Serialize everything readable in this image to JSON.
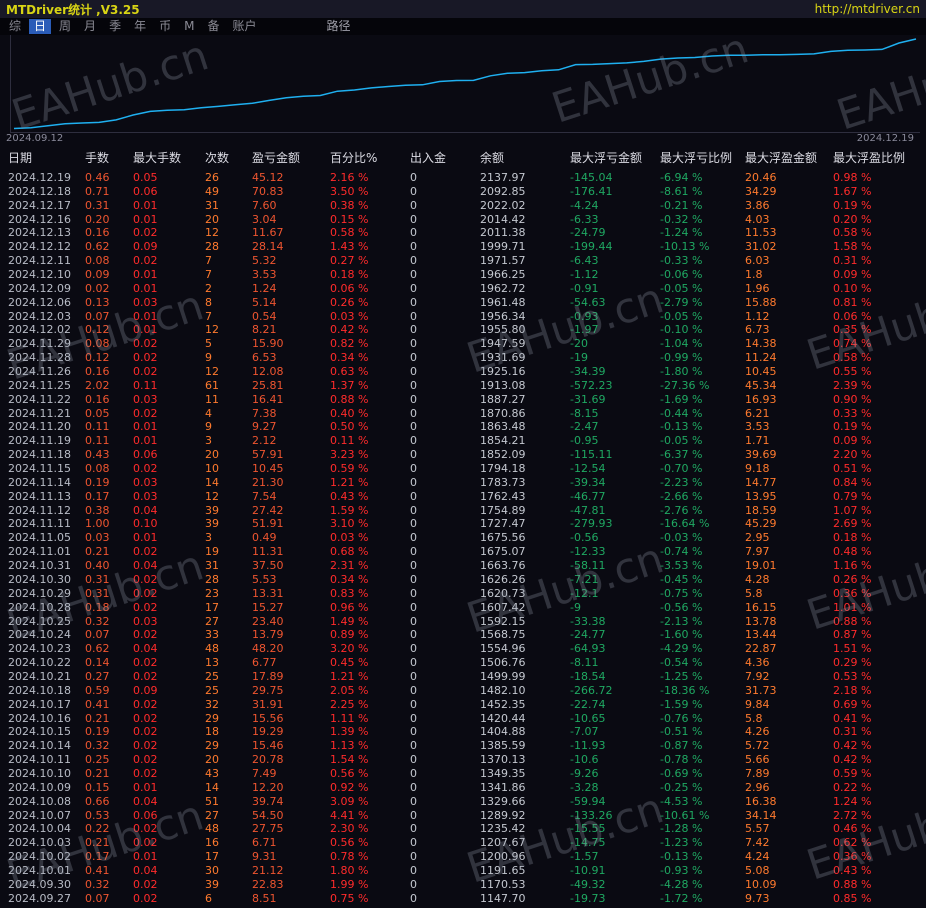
{
  "titlebar": {
    "title": "MTDriver统计 ,V3.25",
    "url": "http://mtdriver.cn"
  },
  "menu": {
    "items": [
      {
        "label": "综",
        "active": false
      },
      {
        "label": "日",
        "active": true
      },
      {
        "label": "周",
        "active": false
      },
      {
        "label": "月",
        "active": false
      },
      {
        "label": "季",
        "active": false
      },
      {
        "label": "年",
        "active": false
      },
      {
        "label": "币",
        "active": false
      },
      {
        "label": "M",
        "active": false
      },
      {
        "label": "备",
        "active": false
      },
      {
        "label": "账户",
        "active": false
      }
    ],
    "path_label": "路径"
  },
  "watermark": {
    "text": "EAHub.cn"
  },
  "chart_data": {
    "type": "line",
    "title": "",
    "x_start_label": "2024.09.12",
    "x_end_label": "2024.12.19",
    "line_color": "#1fb0f0",
    "ylim": [
      1100,
      2160
    ],
    "legend": "off",
    "grid": "off",
    "series": [
      {
        "name": "余额",
        "values": [
          1139.19,
          1147.7,
          1170.53,
          1191.65,
          1200.96,
          1207.67,
          1235.42,
          1289.92,
          1329.66,
          1341.86,
          1349.35,
          1370.13,
          1385.59,
          1404.88,
          1420.44,
          1452.35,
          1482.1,
          1499.99,
          1506.76,
          1554.96,
          1568.75,
          1592.15,
          1607.42,
          1620.73,
          1626.26,
          1663.76,
          1675.07,
          1675.56,
          1727.47,
          1754.89,
          1762.43,
          1783.73,
          1794.18,
          1852.09,
          1854.21,
          1863.48,
          1870.86,
          1887.27,
          1913.08,
          1925.16,
          1931.69,
          1947.59,
          1955.8,
          1956.34,
          1961.48,
          1962.72,
          1966.25,
          1971.57,
          1999.71,
          2011.38,
          2014.42,
          2022.02,
          2092.85,
          2137.97
        ]
      }
    ]
  },
  "table": {
    "headers": [
      "日期",
      "手数",
      "最大手数",
      "次数",
      "盈亏金额",
      "百分比%",
      "出入金",
      "余额",
      "最大浮亏金额",
      "最大浮亏比例",
      "最大浮盈金额",
      "最大浮盈比例"
    ],
    "rows": [
      [
        "2024.12.19",
        "0.46",
        "0.05",
        "26",
        "45.12",
        "2.16 %",
        "0",
        "2137.97",
        "-145.04",
        "-6.94 %",
        "20.46",
        "0.98 %"
      ],
      [
        "2024.12.18",
        "0.71",
        "0.06",
        "49",
        "70.83",
        "3.50 %",
        "0",
        "2092.85",
        "-176.41",
        "-8.61 %",
        "34.29",
        "1.67 %"
      ],
      [
        "2024.12.17",
        "0.31",
        "0.01",
        "31",
        "7.60",
        "0.38 %",
        "0",
        "2022.02",
        "-4.24",
        "-0.21 %",
        "3.86",
        "0.19 %"
      ],
      [
        "2024.12.16",
        "0.20",
        "0.01",
        "20",
        "3.04",
        "0.15 %",
        "0",
        "2014.42",
        "-6.33",
        "-0.32 %",
        "4.03",
        "0.20 %"
      ],
      [
        "2024.12.13",
        "0.16",
        "0.02",
        "12",
        "11.67",
        "0.58 %",
        "0",
        "2011.38",
        "-24.79",
        "-1.24 %",
        "11.53",
        "0.58 %"
      ],
      [
        "2024.12.12",
        "0.62",
        "0.09",
        "28",
        "28.14",
        "1.43 %",
        "0",
        "1999.71",
        "-199.44",
        "-10.13 %",
        "31.02",
        "1.58 %"
      ],
      [
        "2024.12.11",
        "0.08",
        "0.02",
        "7",
        "5.32",
        "0.27 %",
        "0",
        "1971.57",
        "-6.43",
        "-0.33 %",
        "6.03",
        "0.31 %"
      ],
      [
        "2024.12.10",
        "0.09",
        "0.01",
        "7",
        "3.53",
        "0.18 %",
        "0",
        "1966.25",
        "-1.12",
        "-0.06 %",
        "1.8",
        "0.09 %"
      ],
      [
        "2024.12.09",
        "0.02",
        "0.01",
        "2",
        "1.24",
        "0.06 %",
        "0",
        "1962.72",
        "-0.91",
        "-0.05 %",
        "1.96",
        "0.10 %"
      ],
      [
        "2024.12.06",
        "0.13",
        "0.03",
        "8",
        "5.14",
        "0.26 %",
        "0",
        "1961.48",
        "-54.63",
        "-2.79 %",
        "15.88",
        "0.81 %"
      ],
      [
        "2024.12.03",
        "0.07",
        "0.01",
        "7",
        "0.54",
        "0.03 %",
        "0",
        "1956.34",
        "-0.93",
        "-0.05 %",
        "1.12",
        "0.06 %"
      ],
      [
        "2024.12.02",
        "0.12",
        "0.01",
        "12",
        "8.21",
        "0.42 %",
        "0",
        "1955.80",
        "-1.97",
        "-0.10 %",
        "6.73",
        "0.35 %"
      ],
      [
        "2024.11.29",
        "0.08",
        "0.02",
        "5",
        "15.90",
        "0.82 %",
        "0",
        "1947.59",
        "-20",
        "-1.04 %",
        "14.38",
        "0.74 %"
      ],
      [
        "2024.11.28",
        "0.12",
        "0.02",
        "9",
        "6.53",
        "0.34 %",
        "0",
        "1931.69",
        "-19",
        "-0.99 %",
        "11.24",
        "0.58 %"
      ],
      [
        "2024.11.26",
        "0.16",
        "0.02",
        "12",
        "12.08",
        "0.63 %",
        "0",
        "1925.16",
        "-34.39",
        "-1.80 %",
        "10.45",
        "0.55 %"
      ],
      [
        "2024.11.25",
        "2.02",
        "0.11",
        "61",
        "25.81",
        "1.37 %",
        "0",
        "1913.08",
        "-572.23",
        "-27.36 %",
        "45.34",
        "2.39 %"
      ],
      [
        "2024.11.22",
        "0.16",
        "0.03",
        "11",
        "16.41",
        "0.88 %",
        "0",
        "1887.27",
        "-31.69",
        "-1.69 %",
        "16.93",
        "0.90 %"
      ],
      [
        "2024.11.21",
        "0.05",
        "0.02",
        "4",
        "7.38",
        "0.40 %",
        "0",
        "1870.86",
        "-8.15",
        "-0.44 %",
        "6.21",
        "0.33 %"
      ],
      [
        "2024.11.20",
        "0.11",
        "0.01",
        "9",
        "9.27",
        "0.50 %",
        "0",
        "1863.48",
        "-2.47",
        "-0.13 %",
        "3.53",
        "0.19 %"
      ],
      [
        "2024.11.19",
        "0.11",
        "0.01",
        "3",
        "2.12",
        "0.11 %",
        "0",
        "1854.21",
        "-0.95",
        "-0.05 %",
        "1.71",
        "0.09 %"
      ],
      [
        "2024.11.18",
        "0.43",
        "0.06",
        "20",
        "57.91",
        "3.23 %",
        "0",
        "1852.09",
        "-115.11",
        "-6.37 %",
        "39.69",
        "2.20 %"
      ],
      [
        "2024.11.15",
        "0.08",
        "0.02",
        "10",
        "10.45",
        "0.59 %",
        "0",
        "1794.18",
        "-12.54",
        "-0.70 %",
        "9.18",
        "0.51 %"
      ],
      [
        "2024.11.14",
        "0.19",
        "0.03",
        "14",
        "21.30",
        "1.21 %",
        "0",
        "1783.73",
        "-39.34",
        "-2.23 %",
        "14.77",
        "0.84 %"
      ],
      [
        "2024.11.13",
        "0.17",
        "0.03",
        "12",
        "7.54",
        "0.43 %",
        "0",
        "1762.43",
        "-46.77",
        "-2.66 %",
        "13.95",
        "0.79 %"
      ],
      [
        "2024.11.12",
        "0.38",
        "0.04",
        "39",
        "27.42",
        "1.59 %",
        "0",
        "1754.89",
        "-47.81",
        "-2.76 %",
        "18.59",
        "1.07 %"
      ],
      [
        "2024.11.11",
        "1.00",
        "0.10",
        "39",
        "51.91",
        "3.10 %",
        "0",
        "1727.47",
        "-279.93",
        "-16.64 %",
        "45.29",
        "2.69 %"
      ],
      [
        "2024.11.05",
        "0.03",
        "0.01",
        "3",
        "0.49",
        "0.03 %",
        "0",
        "1675.56",
        "-0.56",
        "-0.03 %",
        "2.95",
        "0.18 %"
      ],
      [
        "2024.11.01",
        "0.21",
        "0.02",
        "19",
        "11.31",
        "0.68 %",
        "0",
        "1675.07",
        "-12.33",
        "-0.74 %",
        "7.97",
        "0.48 %"
      ],
      [
        "2024.10.31",
        "0.40",
        "0.04",
        "31",
        "37.50",
        "2.31 %",
        "0",
        "1663.76",
        "-58.11",
        "-3.53 %",
        "19.01",
        "1.16 %"
      ],
      [
        "2024.10.30",
        "0.31",
        "0.02",
        "28",
        "5.53",
        "0.34 %",
        "0",
        "1626.26",
        "-7.21",
        "-0.45 %",
        "4.28",
        "0.26 %"
      ],
      [
        "2024.10.29",
        "0.31",
        "0.02",
        "23",
        "13.31",
        "0.83 %",
        "0",
        "1620.73",
        "-12.1",
        "-0.75 %",
        "5.8",
        "0.36 %"
      ],
      [
        "2024.10.28",
        "0.18",
        "0.02",
        "17",
        "15.27",
        "0.96 %",
        "0",
        "1607.42",
        "-9",
        "-0.56 %",
        "16.15",
        "1.01 %"
      ],
      [
        "2024.10.25",
        "0.32",
        "0.03",
        "27",
        "23.40",
        "1.49 %",
        "0",
        "1592.15",
        "-33.38",
        "-2.13 %",
        "13.78",
        "0.88 %"
      ],
      [
        "2024.10.24",
        "0.07",
        "0.02",
        "33",
        "13.79",
        "0.89 %",
        "0",
        "1568.75",
        "-24.77",
        "-1.60 %",
        "13.44",
        "0.87 %"
      ],
      [
        "2024.10.23",
        "0.62",
        "0.04",
        "48",
        "48.20",
        "3.20 %",
        "0",
        "1554.96",
        "-64.93",
        "-4.29 %",
        "22.87",
        "1.51 %"
      ],
      [
        "2024.10.22",
        "0.14",
        "0.02",
        "13",
        "6.77",
        "0.45 %",
        "0",
        "1506.76",
        "-8.11",
        "-0.54 %",
        "4.36",
        "0.29 %"
      ],
      [
        "2024.10.21",
        "0.27",
        "0.02",
        "25",
        "17.89",
        "1.21 %",
        "0",
        "1499.99",
        "-18.54",
        "-1.25 %",
        "7.92",
        "0.53 %"
      ],
      [
        "2024.10.18",
        "0.59",
        "0.09",
        "25",
        "29.75",
        "2.05 %",
        "0",
        "1482.10",
        "-266.72",
        "-18.36 %",
        "31.73",
        "2.18 %"
      ],
      [
        "2024.10.17",
        "0.41",
        "0.02",
        "32",
        "31.91",
        "2.25 %",
        "0",
        "1452.35",
        "-22.74",
        "-1.59 %",
        "9.84",
        "0.69 %"
      ],
      [
        "2024.10.16",
        "0.21",
        "0.02",
        "29",
        "15.56",
        "1.11 %",
        "0",
        "1420.44",
        "-10.65",
        "-0.76 %",
        "5.8",
        "0.41 %"
      ],
      [
        "2024.10.15",
        "0.19",
        "0.02",
        "18",
        "19.29",
        "1.39 %",
        "0",
        "1404.88",
        "-7.07",
        "-0.51 %",
        "4.26",
        "0.31 %"
      ],
      [
        "2024.10.14",
        "0.32",
        "0.02",
        "29",
        "15.46",
        "1.13 %",
        "0",
        "1385.59",
        "-11.93",
        "-0.87 %",
        "5.72",
        "0.42 %"
      ],
      [
        "2024.10.11",
        "0.25",
        "0.02",
        "20",
        "20.78",
        "1.54 %",
        "0",
        "1370.13",
        "-10.6",
        "-0.78 %",
        "5.66",
        "0.42 %"
      ],
      [
        "2024.10.10",
        "0.21",
        "0.02",
        "43",
        "7.49",
        "0.56 %",
        "0",
        "1349.35",
        "-9.26",
        "-0.69 %",
        "7.89",
        "0.59 %"
      ],
      [
        "2024.10.09",
        "0.15",
        "0.01",
        "14",
        "12.20",
        "0.92 %",
        "0",
        "1341.86",
        "-3.28",
        "-0.25 %",
        "2.96",
        "0.22 %"
      ],
      [
        "2024.10.08",
        "0.66",
        "0.04",
        "51",
        "39.74",
        "3.09 %",
        "0",
        "1329.66",
        "-59.94",
        "-4.53 %",
        "16.38",
        "1.24 %"
      ],
      [
        "2024.10.07",
        "0.53",
        "0.06",
        "27",
        "54.50",
        "4.41 %",
        "0",
        "1289.92",
        "-133.26",
        "-10.61 %",
        "34.14",
        "2.72 %"
      ],
      [
        "2024.10.04",
        "0.22",
        "0.02",
        "48",
        "27.75",
        "2.30 %",
        "0",
        "1235.42",
        "-15.55",
        "-1.28 %",
        "5.57",
        "0.46 %"
      ],
      [
        "2024.10.03",
        "0.21",
        "0.02",
        "16",
        "6.71",
        "0.56 %",
        "0",
        "1207.67",
        "-14.75",
        "-1.23 %",
        "7.42",
        "0.62 %"
      ],
      [
        "2024.10.02",
        "0.17",
        "0.01",
        "17",
        "9.31",
        "0.78 %",
        "0",
        "1200.96",
        "-1.57",
        "-0.13 %",
        "4.24",
        "0.36 %"
      ],
      [
        "2024.10.01",
        "0.41",
        "0.04",
        "30",
        "21.12",
        "1.80 %",
        "0",
        "1191.65",
        "-10.91",
        "-0.93 %",
        "5.08",
        "0.43 %"
      ],
      [
        "2024.09.30",
        "0.32",
        "0.02",
        "39",
        "22.83",
        "1.99 %",
        "0",
        "1170.53",
        "-49.32",
        "-4.28 %",
        "10.09",
        "0.88 %"
      ],
      [
        "2024.09.27",
        "0.07",
        "0.02",
        "6",
        "8.51",
        "0.75 %",
        "0",
        "1147.70",
        "-19.73",
        "-1.72 %",
        "9.73",
        "0.85 %"
      ]
    ]
  },
  "colors": {
    "bg": "#0a0a12",
    "titlebar_bg": "#181826",
    "title_text": "#d8d414",
    "menu_active_bg": "#2a5cb8",
    "red": "#ff2b2b",
    "orange": "#ff7a2e",
    "red_orange": "#ee5530",
    "green": "#1fa862",
    "line": "#1fb0f0"
  }
}
